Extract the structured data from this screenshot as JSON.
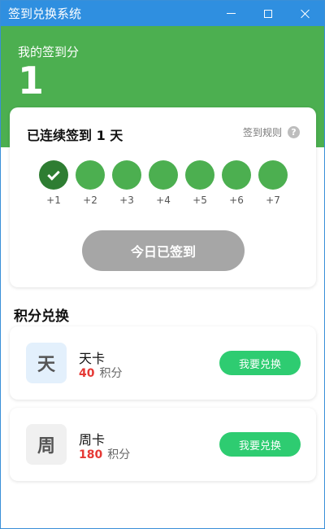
{
  "window": {
    "title": "签到兑换系统"
  },
  "header": {
    "label": "我的签到分",
    "points": "1"
  },
  "checkin": {
    "streak_text": "已连续签到 1 天",
    "rules_label": "签到规则",
    "help_icon": "?",
    "days": [
      {
        "reward": "+1",
        "done": true
      },
      {
        "reward": "+2",
        "done": false
      },
      {
        "reward": "+3",
        "done": false
      },
      {
        "reward": "+4",
        "done": false
      },
      {
        "reward": "+5",
        "done": false
      },
      {
        "reward": "+6",
        "done": false
      },
      {
        "reward": "+7",
        "done": false
      }
    ],
    "button_label": "今日已签到"
  },
  "exchange": {
    "title": "积分兑换",
    "items": [
      {
        "icon_text": "天",
        "name": "天卡",
        "price": "40",
        "unit": "积分",
        "button": "我要兑换",
        "icon_bg": "#e3f0fc",
        "icon_color": "#555555"
      },
      {
        "icon_text": "周",
        "name": "周卡",
        "price": "180",
        "unit": "积分",
        "button": "我要兑换",
        "icon_bg": "#f0f0f0",
        "icon_color": "#555555"
      }
    ]
  },
  "colors": {
    "accent": "#4caf50",
    "done": "#2e7d32",
    "titlebar": "#2f8fe0",
    "exchange_button": "#2ecc71",
    "price": "#e53935"
  }
}
